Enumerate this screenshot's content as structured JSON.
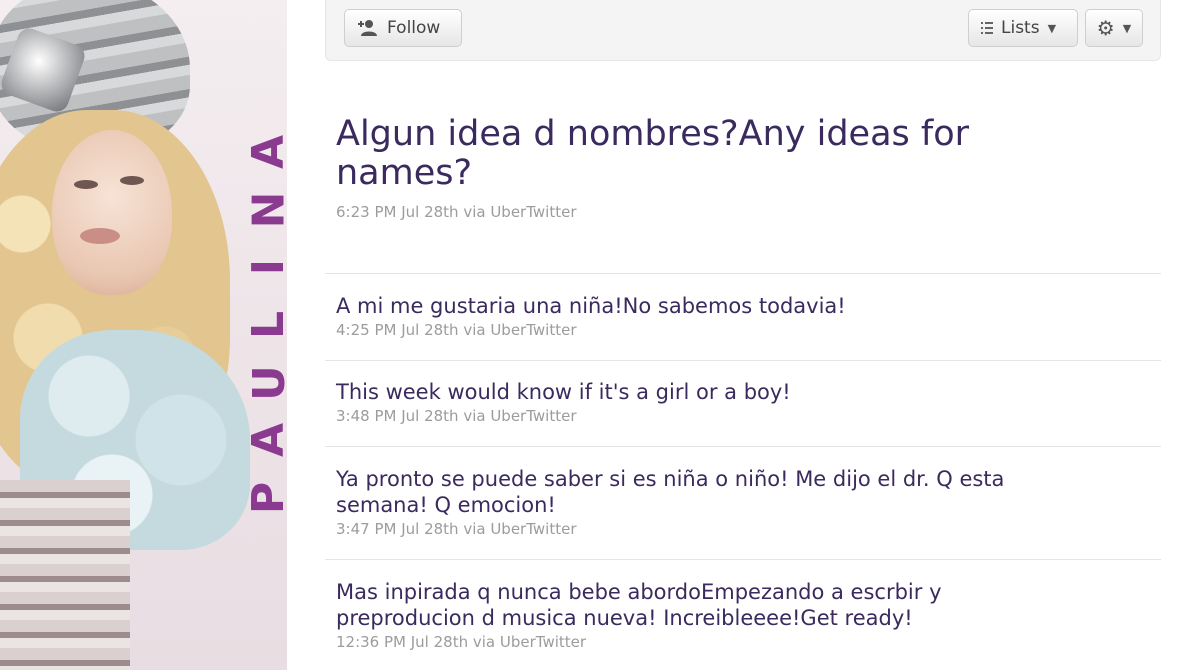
{
  "toolbar": {
    "follow_label": "Follow",
    "lists_label": "Lists",
    "icons": [
      "add-user-icon",
      "list-icon",
      "caret-down-icon",
      "gear-icon"
    ]
  },
  "sidebar_brand": [
    "P",
    "A",
    "U",
    "L",
    "I",
    "N",
    "A"
  ],
  "main_tweet": {
    "text": "Algun idea d nombres?Any ideas for names?",
    "meta": "6:23 PM Jul 28th via UberTwitter"
  },
  "tweets": [
    {
      "text": "A mi me gustaria una niña!No sabemos todavia!",
      "meta": "4:25 PM Jul 28th via UberTwitter"
    },
    {
      "text": "This week would know if it's a girl or a boy!",
      "meta": "3:48 PM Jul 28th via UberTwitter"
    },
    {
      "text": "Ya pronto se puede saber si es niña o niño! Me dijo el dr. Q esta semana! Q emocion!",
      "meta": "3:47 PM Jul 28th via UberTwitter"
    },
    {
      "text": "Mas inpirada q nunca bebe abordoEmpezando a escrbir y preproducion d musica nueva! Increibleeee!Get ready!",
      "meta": "12:36 PM Jul 28th via UberTwitter"
    }
  ],
  "colors": {
    "tweet_text": "#3a2a5e",
    "meta_text": "#9c9c9c",
    "brand_purple": "#8a3b8f"
  }
}
